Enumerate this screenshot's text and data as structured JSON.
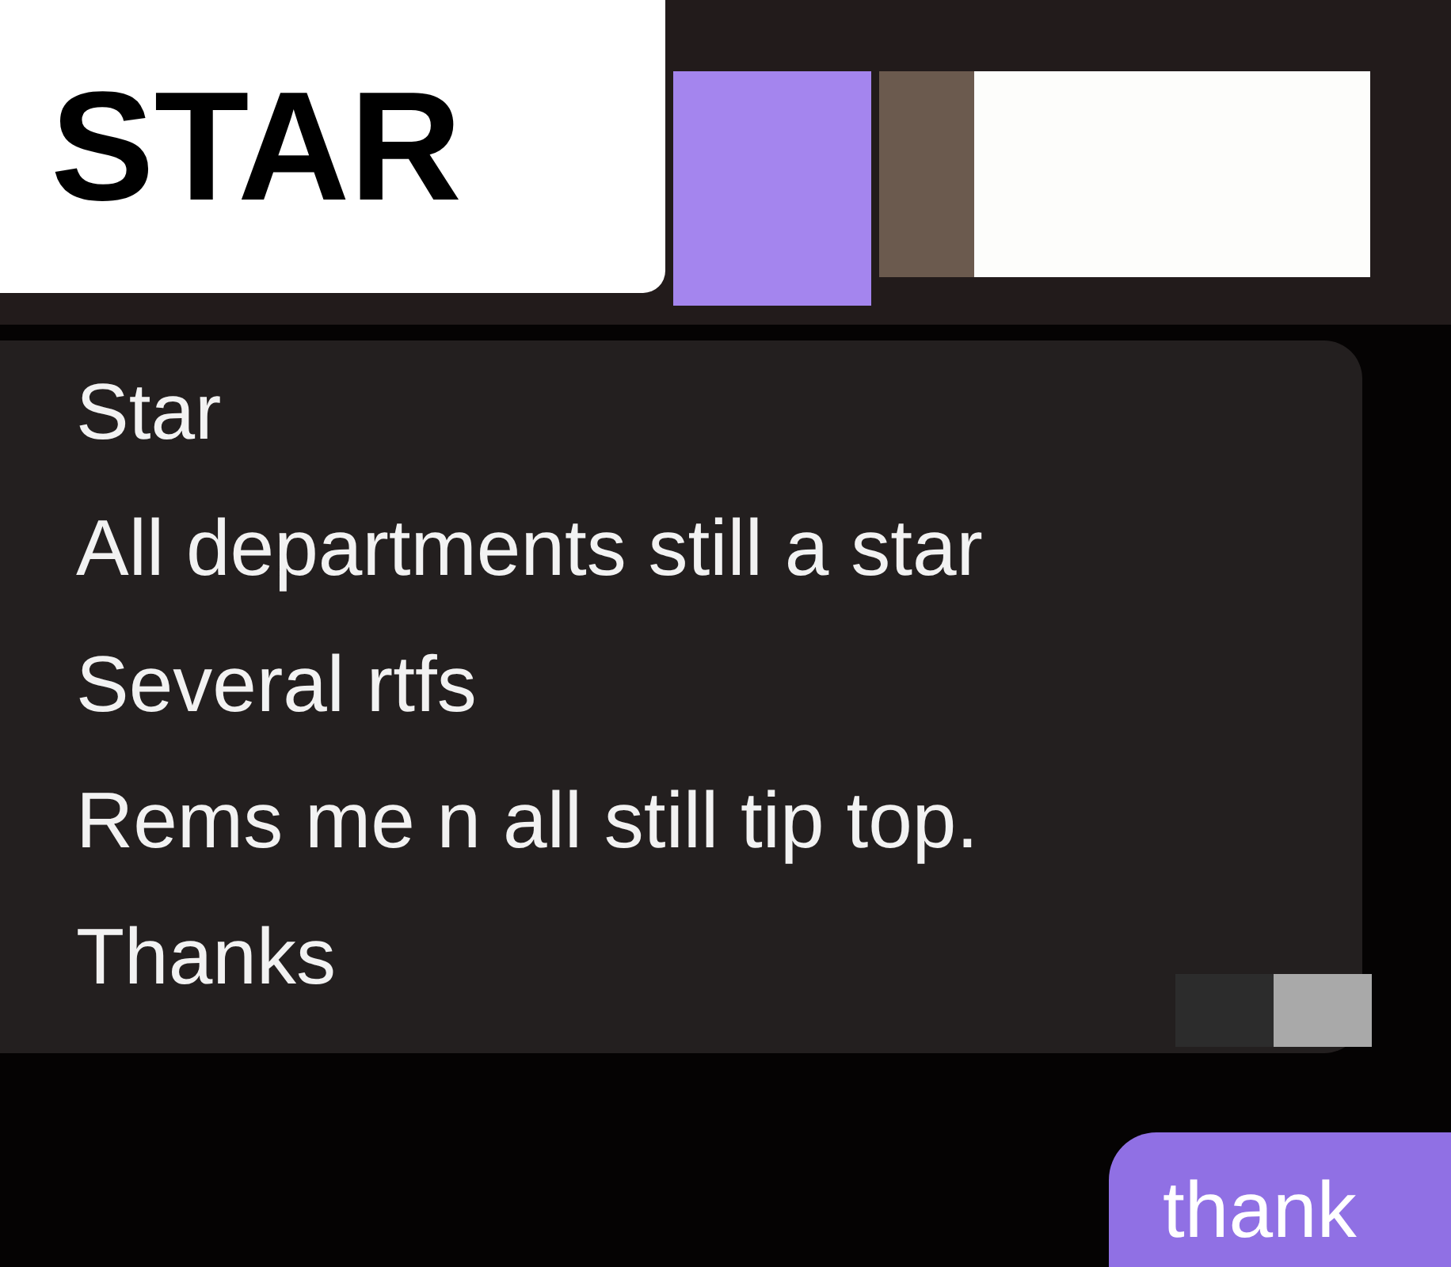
{
  "header": {
    "title": "STAR"
  },
  "messages": [
    {
      "kind": "incoming",
      "lines": [
        "Star",
        "All departments still a star",
        "Several rtfs",
        "Rems me n all still tip top.",
        "Thanks"
      ]
    },
    {
      "kind": "outgoing",
      "lines": [
        "thank"
      ]
    }
  ]
}
